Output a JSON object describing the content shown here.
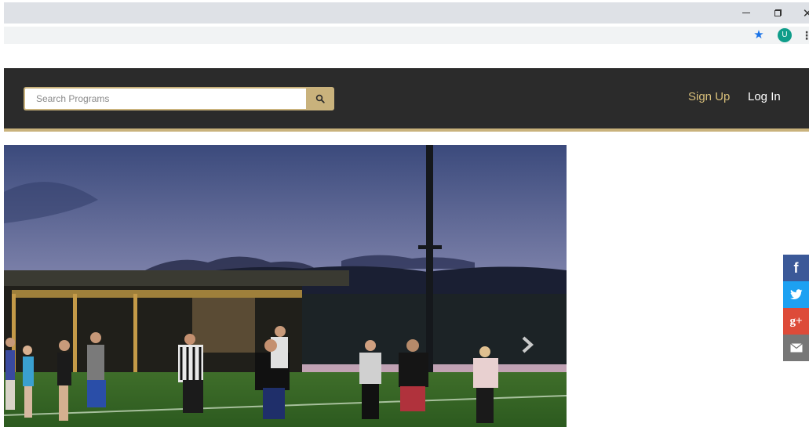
{
  "browser": {
    "minimize_glyph": "–",
    "close_glyph": "✕",
    "bookmark_icon": "star-icon",
    "profile_initial": "U",
    "profile_color": "#0f9d8a",
    "menu_glyph": "⋮"
  },
  "header": {
    "background": "#2b2b2b",
    "accent": "#c9b27c",
    "search": {
      "placeholder": "Search Programs",
      "value": "",
      "icon": "search-icon"
    },
    "nav": {
      "signup_label": "Sign Up",
      "login_label": "Log In"
    }
  },
  "hero": {
    "image": "photo: flag football players on a lit field at dusk with mountains",
    "next_icon": "chevron-right-icon"
  },
  "share": {
    "facebook_glyph": "f",
    "twitter_icon": "twitter-bird-icon",
    "googleplus_glyph": "g+",
    "email_icon": "envelope-icon",
    "colors": {
      "facebook": "#3b5998",
      "twitter": "#1da1f2",
      "googleplus": "#dd4b39",
      "email": "#777777"
    }
  }
}
